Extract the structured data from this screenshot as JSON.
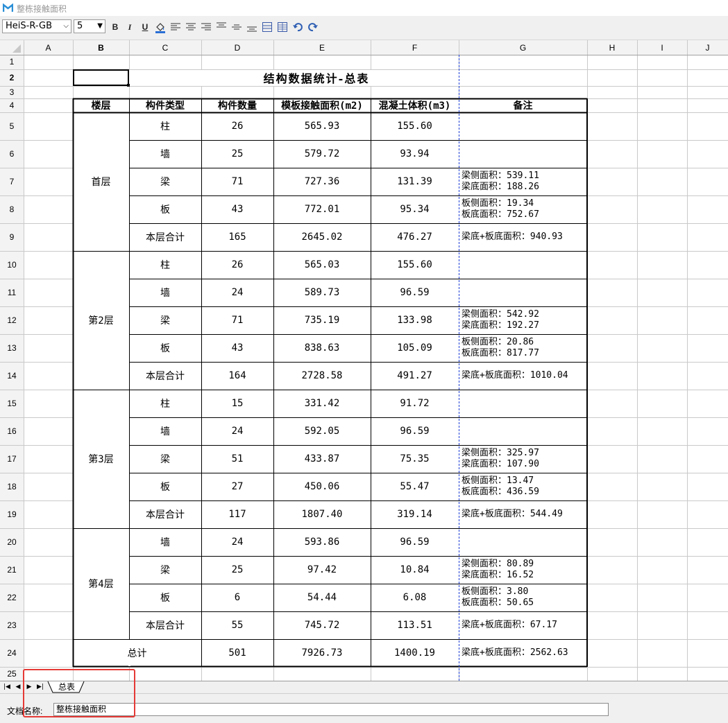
{
  "window": {
    "title": "整栋接触面积"
  },
  "toolbar": {
    "font_name": "HeiS-R-GB",
    "font_size": "5",
    "bold_label": "B",
    "italic_label": "I",
    "underline_label": "U"
  },
  "columns": [
    "A",
    "B",
    "C",
    "D",
    "E",
    "F",
    "G",
    "H",
    "I",
    "J"
  ],
  "rows": [
    "1",
    "2",
    "3",
    "4",
    "5",
    "6",
    "7",
    "8",
    "9",
    "10",
    "11",
    "12",
    "13",
    "14",
    "15",
    "16",
    "17",
    "18",
    "19",
    "20",
    "21",
    "22",
    "23",
    "24",
    "25"
  ],
  "sheet": {
    "title": "结构数据统计-总表",
    "headers": [
      "楼层",
      "构件类型",
      "构件数量",
      "模板接触面积(m2)",
      "混凝土体积(m3)",
      "备注"
    ],
    "floors": [
      {
        "name": "首层",
        "items": [
          [
            "柱",
            "26",
            "565.93",
            "155.60",
            ""
          ],
          [
            "墙",
            "25",
            "579.72",
            "93.94",
            ""
          ],
          [
            "梁",
            "71",
            "727.36",
            "131.39",
            "梁侧面积：539.11|梁底面积：188.26"
          ],
          [
            "板",
            "43",
            "772.01",
            "95.34",
            "板侧面积：19.34|板底面积：752.67"
          ],
          [
            "本层合计",
            "165",
            "2645.02",
            "476.27",
            "梁底+板底面积：940.93"
          ]
        ]
      },
      {
        "name": "第2层",
        "items": [
          [
            "柱",
            "26",
            "565.03",
            "155.60",
            ""
          ],
          [
            "墙",
            "24",
            "589.73",
            "96.59",
            ""
          ],
          [
            "梁",
            "71",
            "735.19",
            "133.98",
            "梁侧面积：542.92|梁底面积：192.27"
          ],
          [
            "板",
            "43",
            "838.63",
            "105.09",
            "板侧面积：20.86|板底面积：817.77"
          ],
          [
            "本层合计",
            "164",
            "2728.58",
            "491.27",
            "梁底+板底面积：1010.04"
          ]
        ]
      },
      {
        "name": "第3层",
        "items": [
          [
            "柱",
            "15",
            "331.42",
            "91.72",
            ""
          ],
          [
            "墙",
            "24",
            "592.05",
            "96.59",
            ""
          ],
          [
            "梁",
            "51",
            "433.87",
            "75.35",
            "梁侧面积：325.97|梁底面积：107.90"
          ],
          [
            "板",
            "27",
            "450.06",
            "55.47",
            "板侧面积：13.47|板底面积：436.59"
          ],
          [
            "本层合计",
            "117",
            "1807.40",
            "319.14",
            "梁底+板底面积：544.49"
          ]
        ]
      },
      {
        "name": "第4层",
        "items": [
          [
            "墙",
            "24",
            "593.86",
            "96.59",
            ""
          ],
          [
            "梁",
            "25",
            "97.42",
            "10.84",
            "梁侧面积：80.89|梁底面积：16.52"
          ],
          [
            "板",
            "6",
            "54.44",
            "6.08",
            "板侧面积：3.80|板底面积：50.65"
          ],
          [
            "本层合计",
            "55",
            "745.72",
            "113.51",
            "梁底+板底面积：67.17"
          ]
        ]
      }
    ],
    "total": {
      "label": "总计",
      "count": "501",
      "area": "7926.73",
      "volume": "1400.19",
      "note": "梁底+板底面积：2562.63"
    }
  },
  "tabs": [
    {
      "label": "总表"
    }
  ],
  "footer": {
    "doc_name_label": "文档名称:",
    "doc_name_value": "整栋接触面积"
  },
  "colors": {
    "highlight_border": "#e53935",
    "grid_line": "#d4d4d4",
    "page_break": "#1f3fd6"
  }
}
